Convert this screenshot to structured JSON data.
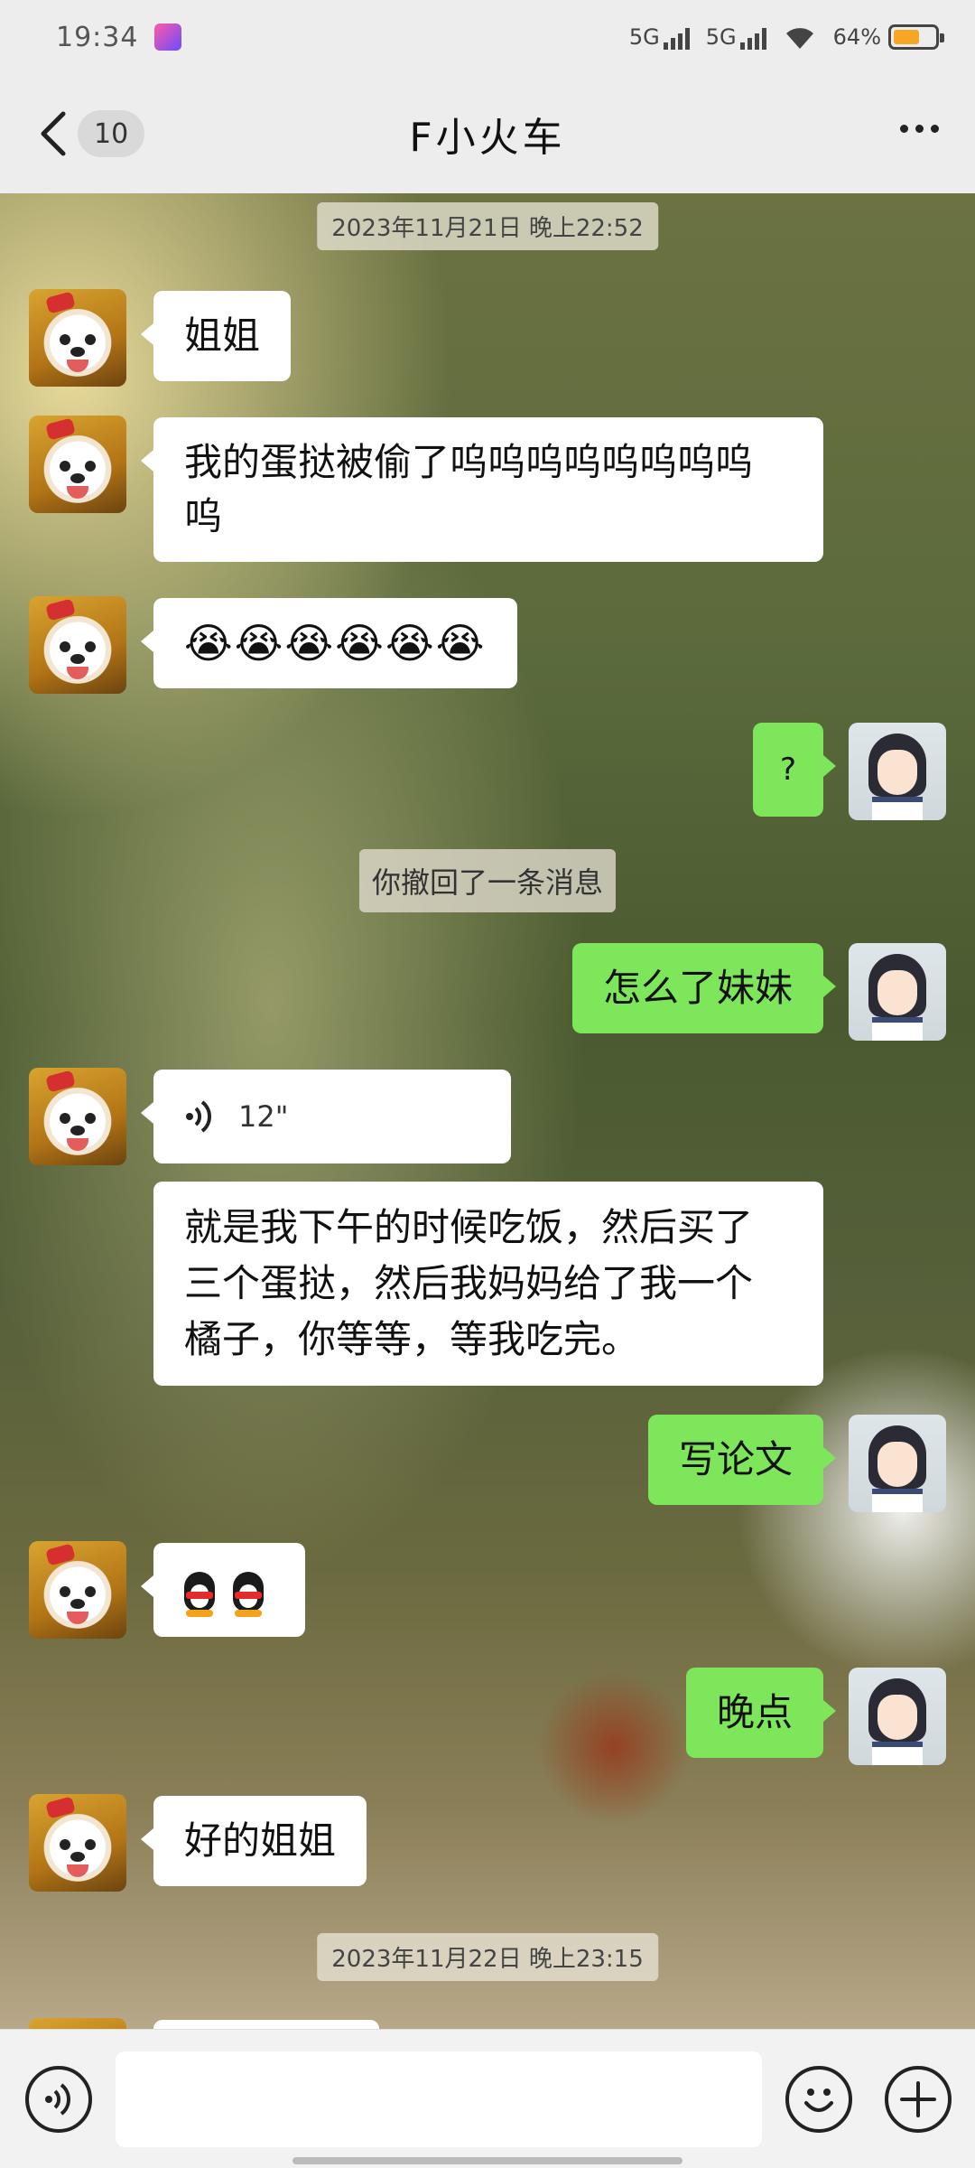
{
  "status_bar": {
    "time": "19:34",
    "network_1": "5G",
    "network_2": "5G",
    "battery": "64%",
    "battery_level": 0.64,
    "colors": {
      "battery_fill": "#f6a623"
    }
  },
  "header": {
    "unread_count": "10",
    "title": "F小火车",
    "icons": {
      "back": "chevron-left-icon",
      "more": "more-icon"
    }
  },
  "messages": [
    {
      "kind": "timestamp",
      "text": "2023年11月21日 晚上22:52"
    },
    {
      "kind": "in",
      "text": "姐姐"
    },
    {
      "kind": "in",
      "text": "我的蛋挞被偷了呜呜呜呜呜呜呜呜\n呜"
    },
    {
      "kind": "in",
      "text": "😭😭😭😭😭😭"
    },
    {
      "kind": "out",
      "text": "?"
    },
    {
      "kind": "system",
      "text": "你撤回了一条消息"
    },
    {
      "kind": "out",
      "text": "怎么了妹妹"
    },
    {
      "kind": "voice",
      "duration": "12\""
    },
    {
      "kind": "in",
      "text": "就是我下午的时候吃饭，然后买了\n三个蛋挞，然后我妈妈给了我一个\n橘子，你等等，等我吃完。"
    },
    {
      "kind": "out",
      "text": "写论文"
    },
    {
      "kind": "in_stickers",
      "icons": [
        "penguin-icon",
        "penguin-icon"
      ]
    },
    {
      "kind": "out",
      "text": "晚点"
    },
    {
      "kind": "in",
      "text": "好的姐姐"
    },
    {
      "kind": "timestamp",
      "text": "2023年11月22日 晚上23:15"
    }
  ],
  "input_bar": {
    "placeholder": "",
    "icons": {
      "voice": "voice-icon",
      "emoji": "emoji-icon",
      "plus": "plus-icon"
    }
  },
  "colors": {
    "header_bg": "#ededed",
    "outgoing_bubble": "#7ee65a",
    "incoming_bubble": "#ffffff"
  }
}
